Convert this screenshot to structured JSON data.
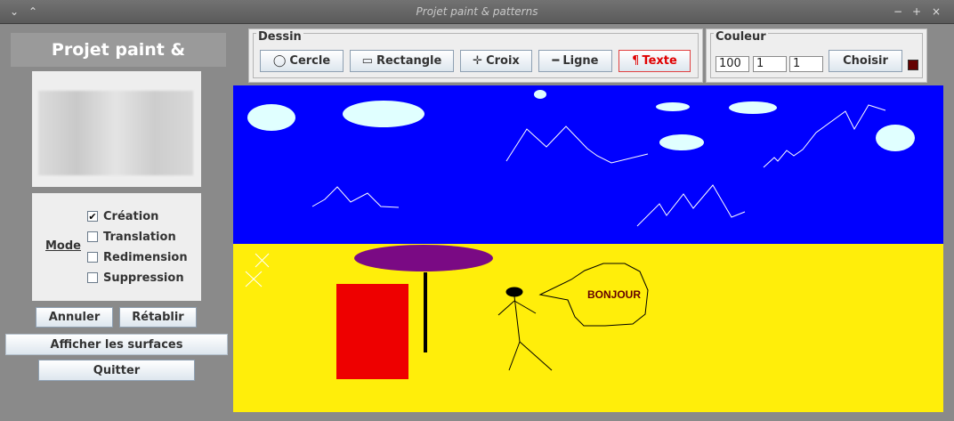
{
  "window": {
    "title": "Projet paint & patterns",
    "menu_icon": "chevron-down-icon",
    "restore_icon": "restore-icon",
    "controls": [
      "minimize-icon",
      "maximize-icon",
      "close-icon"
    ]
  },
  "sidebar": {
    "app_title": "Projet paint & patterns",
    "mode_label": "Mode",
    "modes": [
      {
        "label": "Création",
        "checked": true
      },
      {
        "label": "Translation",
        "checked": false
      },
      {
        "label": "Redimension",
        "checked": false
      },
      {
        "label": "Suppression",
        "checked": false
      }
    ],
    "undo_label": "Annuler",
    "redo_label": "Rétablir",
    "show_surfaces_label": "Afficher les surfaces",
    "quit_label": "Quitter"
  },
  "toolbar": {
    "drawing_legend": "Dessin",
    "tools": [
      {
        "label": "Cercle",
        "icon": "circle-icon",
        "glyph": "◯",
        "active": false
      },
      {
        "label": "Rectangle",
        "icon": "rectangle-icon",
        "glyph": "▭",
        "active": false
      },
      {
        "label": "Croix",
        "icon": "cross-icon",
        "glyph": "✛",
        "active": false
      },
      {
        "label": "Ligne",
        "icon": "line-icon",
        "glyph": "━",
        "active": false
      },
      {
        "label": "Texte",
        "icon": "pilcrow-icon",
        "glyph": "¶",
        "active": true
      }
    ]
  },
  "color": {
    "legend": "Couleur",
    "r": "100",
    "g": "1",
    "b": "1",
    "choose_label": "Choisir",
    "swatch": "#640101"
  },
  "canvas": {
    "sky_color": "#0000ff",
    "sand_color": "#ffee0a",
    "speech_text": "BONJOUR",
    "umbrella_color": "#7a0a84",
    "towel_color": "#ee0000",
    "cloud_color": "#e0ffff",
    "speech_text_color": "#640101"
  }
}
